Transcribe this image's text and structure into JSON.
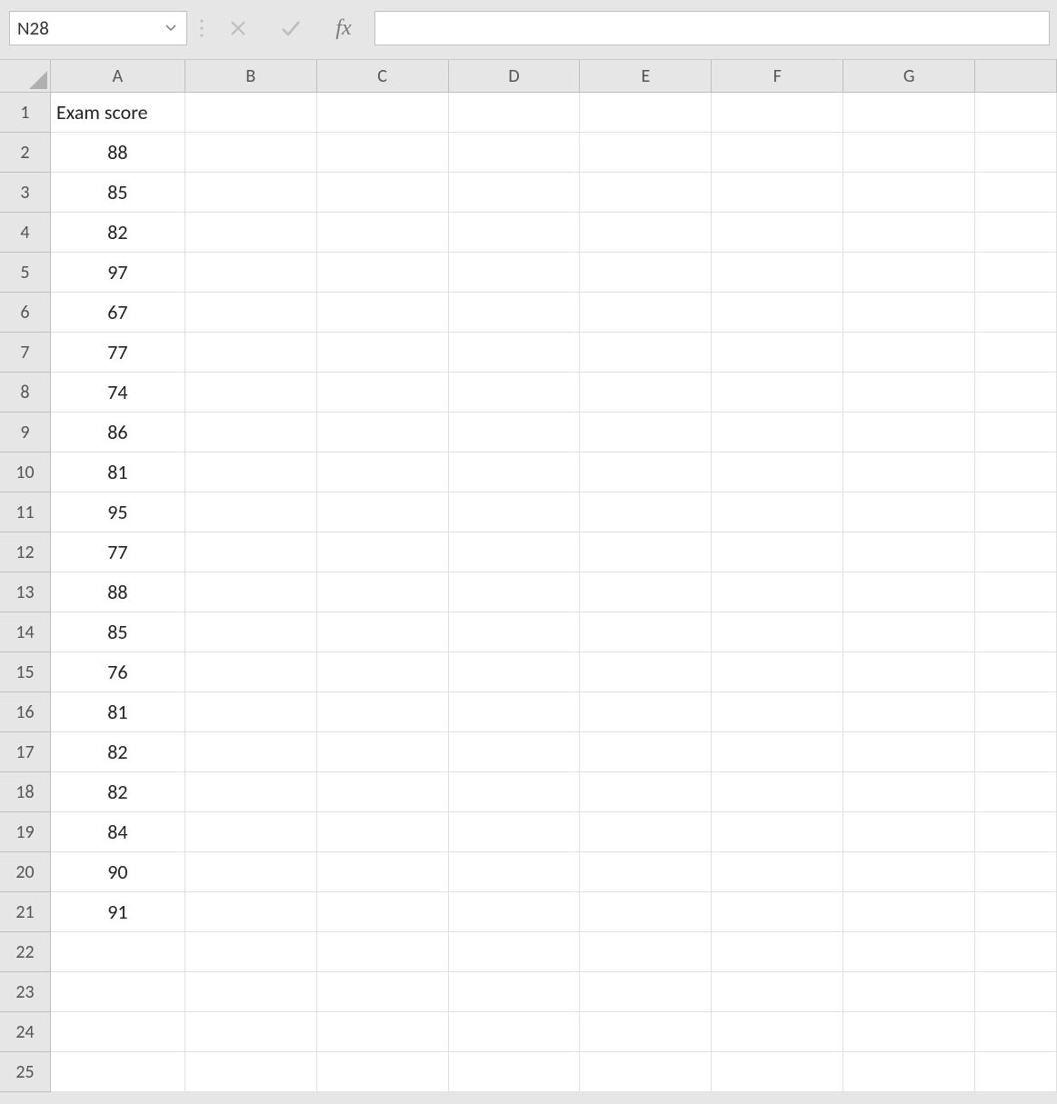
{
  "nameBox": {
    "value": "N28"
  },
  "formulaBar": {
    "fxLabel": "fx",
    "value": ""
  },
  "columns": [
    "A",
    "B",
    "C",
    "D",
    "E",
    "F",
    "G"
  ],
  "rowCount": 25,
  "colWidths": {
    "A": 148,
    "B": 145,
    "C": 145,
    "D": 145,
    "E": 145,
    "F": 145,
    "G": 145
  },
  "cells": {
    "A1": {
      "value": "Exam score",
      "align": "left"
    },
    "A2": {
      "value": "88",
      "align": "center"
    },
    "A3": {
      "value": "85",
      "align": "center"
    },
    "A4": {
      "value": "82",
      "align": "center"
    },
    "A5": {
      "value": "97",
      "align": "center"
    },
    "A6": {
      "value": "67",
      "align": "center"
    },
    "A7": {
      "value": "77",
      "align": "center"
    },
    "A8": {
      "value": "74",
      "align": "center"
    },
    "A9": {
      "value": "86",
      "align": "center"
    },
    "A10": {
      "value": "81",
      "align": "center"
    },
    "A11": {
      "value": "95",
      "align": "center"
    },
    "A12": {
      "value": "77",
      "align": "center"
    },
    "A13": {
      "value": "88",
      "align": "center"
    },
    "A14": {
      "value": "85",
      "align": "center"
    },
    "A15": {
      "value": "76",
      "align": "center"
    },
    "A16": {
      "value": "81",
      "align": "center"
    },
    "A17": {
      "value": "82",
      "align": "center"
    },
    "A18": {
      "value": "82",
      "align": "center"
    },
    "A19": {
      "value": "84",
      "align": "center"
    },
    "A20": {
      "value": "90",
      "align": "center"
    },
    "A21": {
      "value": "91",
      "align": "center"
    }
  }
}
